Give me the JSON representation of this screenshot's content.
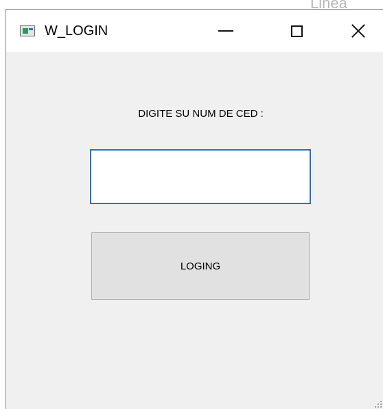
{
  "background": {
    "partial_text": "Linea"
  },
  "window": {
    "title": "W_LOGIN",
    "controls": {
      "minimize": "minimize",
      "maximize": "maximize",
      "close": "close"
    }
  },
  "form": {
    "prompt": "DIGITE SU NUM DE CED :",
    "input_value": "",
    "input_placeholder": "",
    "login_button": "LOGING"
  },
  "colors": {
    "input_focus_border": "#1e73cf",
    "button_bg": "#e1e1e1",
    "client_bg": "#f0f0f0"
  }
}
